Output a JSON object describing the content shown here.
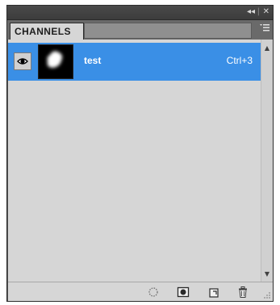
{
  "panel": {
    "tab_label": "CHANNELS",
    "collapse_icon": "double-chevron-left-icon",
    "close_icon": "close-icon",
    "menu_icon": "panel-menu-icon"
  },
  "channels": [
    {
      "name": "test",
      "shortcut": "Ctrl+3",
      "visible": true,
      "selected": true,
      "thumbnail": "white-blob-mask-on-black"
    }
  ],
  "footer": {
    "buttons": [
      "load-channel-as-selection-icon",
      "save-selection-as-channel-icon",
      "new-channel-icon",
      "delete-channel-icon"
    ]
  },
  "colors": {
    "selection": "#3a8fe6",
    "panel_bg": "#d6d6d6",
    "chrome": "#535353"
  }
}
